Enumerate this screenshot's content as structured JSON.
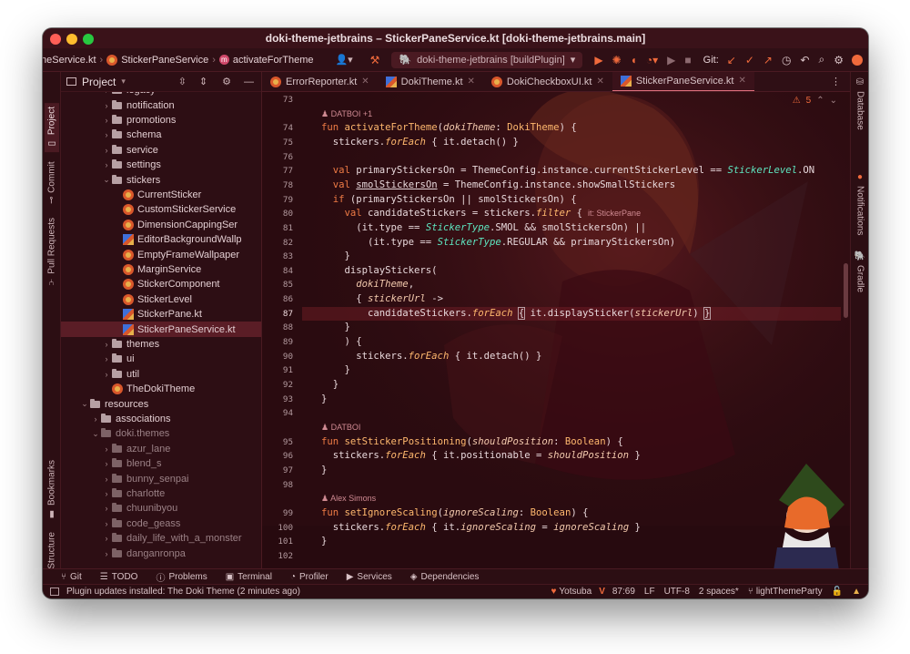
{
  "window": {
    "title": "doki-theme-jetbrains – StickerPaneService.kt [doki-theme-jetbrains.main]"
  },
  "navbar": {
    "breadcrumbs": [
      "neService.kt",
      "StickerPaneService",
      "activateForTheme"
    ],
    "run_config": "doki-theme-jetbrains [buildPlugin]",
    "git_label": "Git:"
  },
  "left_tools": {
    "project": "Project",
    "commit": "Commit",
    "pull_requests": "Pull Requests",
    "bookmarks": "Bookmarks",
    "structure": "Structure"
  },
  "right_tools": {
    "database": "Database",
    "notifications": "Notifications",
    "gradle": "Gradle"
  },
  "project_panel": {
    "title": "Project",
    "tree": [
      {
        "label": "legacy",
        "type": "folder",
        "indent": 3,
        "arrow": "›",
        "clipped": true
      },
      {
        "label": "notification",
        "type": "folder",
        "indent": 3,
        "arrow": "›"
      },
      {
        "label": "promotions",
        "type": "folder",
        "indent": 3,
        "arrow": "›"
      },
      {
        "label": "schema",
        "type": "folder",
        "indent": 3,
        "arrow": "›"
      },
      {
        "label": "service",
        "type": "folder",
        "indent": 3,
        "arrow": "›"
      },
      {
        "label": "settings",
        "type": "folder",
        "indent": 3,
        "arrow": "›"
      },
      {
        "label": "stickers",
        "type": "folder",
        "indent": 3,
        "arrow": "⌄"
      },
      {
        "label": "CurrentSticker",
        "type": "kotlin",
        "indent": 4
      },
      {
        "label": "CustomStickerService",
        "type": "kotlin",
        "indent": 4
      },
      {
        "label": "DimensionCappingSer",
        "type": "kotlin",
        "indent": 4
      },
      {
        "label": "EditorBackgroundWallp",
        "type": "kotlin-file",
        "indent": 4
      },
      {
        "label": "EmptyFrameWallpaper",
        "type": "kotlin",
        "indent": 4
      },
      {
        "label": "MarginService",
        "type": "kotlin",
        "indent": 4
      },
      {
        "label": "StickerComponent",
        "type": "kotlin",
        "indent": 4
      },
      {
        "label": "StickerLevel",
        "type": "kotlin",
        "indent": 4
      },
      {
        "label": "StickerPane.kt",
        "type": "kotlin-file",
        "indent": 4
      },
      {
        "label": "StickerPaneService.kt",
        "type": "kotlin-file",
        "indent": 4,
        "selected": true
      },
      {
        "label": "themes",
        "type": "folder",
        "indent": 3,
        "arrow": "›"
      },
      {
        "label": "ui",
        "type": "folder",
        "indent": 3,
        "arrow": "›"
      },
      {
        "label": "util",
        "type": "folder",
        "indent": 3,
        "arrow": "›"
      },
      {
        "label": "TheDokiTheme",
        "type": "kotlin",
        "indent": 3
      },
      {
        "label": "resources",
        "type": "folder-res",
        "indent": 1,
        "arrow": "⌄"
      },
      {
        "label": "associations",
        "type": "folder",
        "indent": 2,
        "arrow": "›"
      },
      {
        "label": "doki.themes",
        "type": "folder-dim",
        "indent": 2,
        "arrow": "⌄"
      },
      {
        "label": "azur_lane",
        "type": "folder-dim",
        "indent": 3,
        "arrow": "›"
      },
      {
        "label": "blend_s",
        "type": "folder-dim",
        "indent": 3,
        "arrow": "›"
      },
      {
        "label": "bunny_senpai",
        "type": "folder-dim",
        "indent": 3,
        "arrow": "›"
      },
      {
        "label": "charlotte",
        "type": "folder-dim",
        "indent": 3,
        "arrow": "›"
      },
      {
        "label": "chuunibyou",
        "type": "folder-dim",
        "indent": 3,
        "arrow": "›"
      },
      {
        "label": "code_geass",
        "type": "folder-dim",
        "indent": 3,
        "arrow": "›"
      },
      {
        "label": "daily_life_with_a_monster",
        "type": "folder-dim",
        "indent": 3,
        "arrow": "›"
      },
      {
        "label": "danganronpa",
        "type": "folder-dim",
        "indent": 3,
        "arrow": "›"
      }
    ]
  },
  "editor": {
    "tabs": [
      {
        "label": "ErrorReporter.kt",
        "icon": "kotlin-class-icon"
      },
      {
        "label": "DokiTheme.kt",
        "icon": "kotlin-file-icon"
      },
      {
        "label": "DokiCheckboxUI.kt",
        "icon": "kotlin-class-icon"
      },
      {
        "label": "StickerPaneService.kt",
        "icon": "kotlin-file-icon",
        "active": true
      }
    ],
    "problems_count": "5",
    "current_line": 87,
    "line_numbers": [
      "73",
      "74",
      "75",
      "76",
      "77",
      "78",
      "79",
      "80",
      "81",
      "82",
      "83",
      "84",
      "85",
      "86",
      "87",
      "88",
      "89",
      "90",
      "91",
      "92",
      "93",
      "94",
      "95",
      "96",
      "97",
      "98",
      "99",
      "100",
      "101",
      "102"
    ],
    "hints": [
      {
        "after_line": 73,
        "text": "DATBOI +1"
      },
      {
        "after_line": 94,
        "text": "DATBOI"
      },
      {
        "after_line": 98,
        "text": "Alex Simons"
      }
    ],
    "inline_hint": "it: StickerPane",
    "code_lines": [
      "",
      "fun activateForTheme(dokiTheme: DokiTheme) {",
      "  stickers.forEach { it.detach() }",
      "",
      "  val primaryStickersOn = ThemeConfig.instance.currentStickerLevel == StickerLevel.ON",
      "  val smolStickersOn = ThemeConfig.instance.showSmallStickers",
      "  if (primaryStickersOn || smolStickersOn) {",
      "    val candidateStickers = stickers.filter {",
      "      (it.type == StickerType.SMOL && smolStickersOn) ||",
      "        (it.type == StickerType.REGULAR && primaryStickersOn)",
      "    }",
      "    displayStickers(",
      "      dokiTheme,",
      "      { stickerUrl ->",
      "        candidateStickers.forEach { it.displaySticker(stickerUrl) }",
      "    }",
      "    ) {",
      "      stickers.forEach { it.detach() }",
      "    }",
      "  }",
      "}",
      "",
      "fun setStickerPositioning(shouldPosition: Boolean) {",
      "  stickers.forEach { it.positionable = shouldPosition }",
      "}",
      "",
      "fun setIgnoreScaling(ignoreScaling: Boolean) {",
      "  stickers.forEach { it.ignoreScaling = ignoreScaling }",
      "}",
      ""
    ]
  },
  "bottom_tools": [
    "Git",
    "TODO",
    "Problems",
    "Terminal",
    "Profiler",
    "Services",
    "Dependencies"
  ],
  "status_bar": {
    "message": "Plugin updates installed: The Doki Theme (2 minutes ago)",
    "theme": "Yotsuba",
    "position": "87:69",
    "line_sep": "LF",
    "encoding": "UTF-8",
    "indent": "2 spaces*",
    "branch": "lightThemeParty"
  },
  "colors": {
    "accent": "#e0707e",
    "background": "#2a0d12",
    "keyword": "#ee7b45",
    "string_enum": "#5ee6c0"
  }
}
